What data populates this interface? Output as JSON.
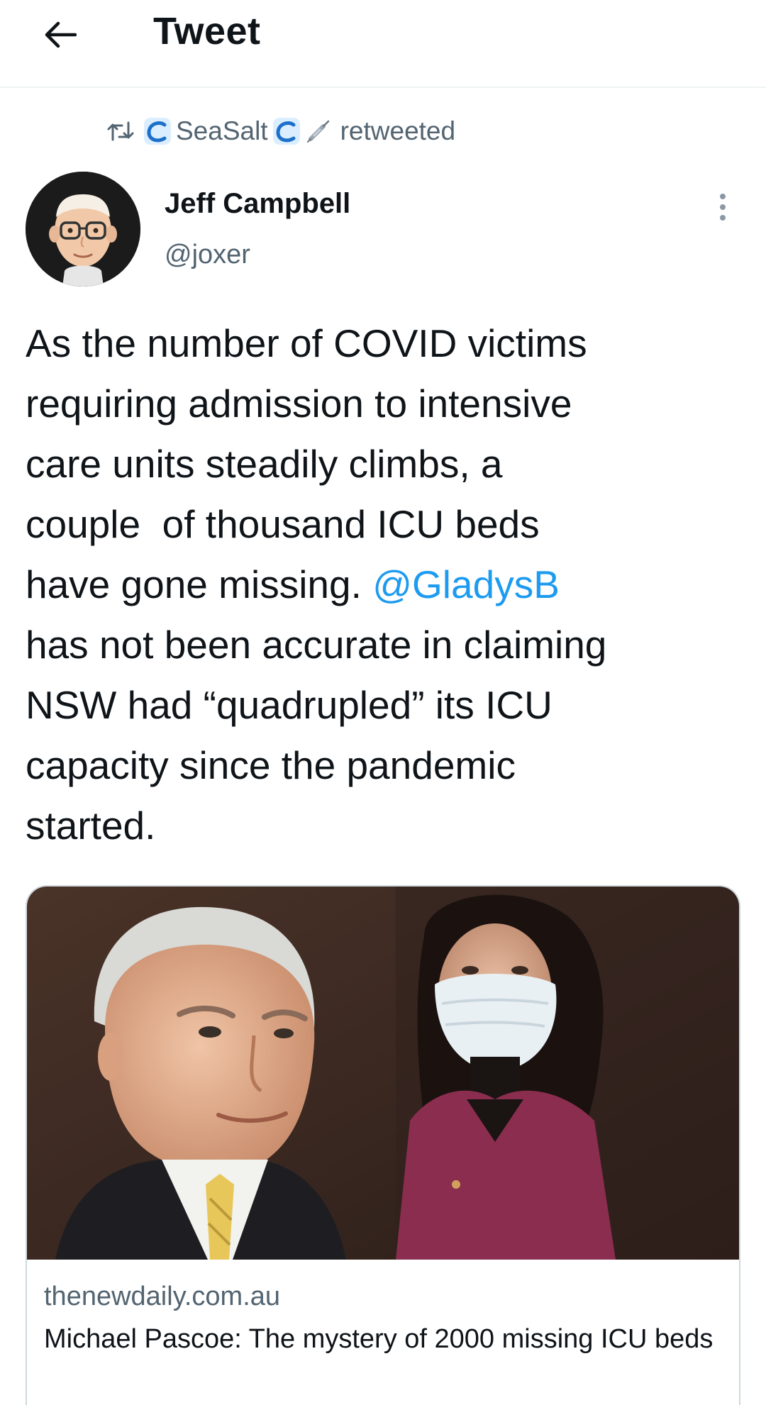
{
  "header": {
    "title": "Tweet",
    "back_icon": "arrow-left-icon"
  },
  "retweet_context": {
    "icon": "retweet-icon",
    "retweeter_name": "SeaSalt",
    "emoji_icons": [
      "water-wave-icon",
      "water-wave-icon",
      "syringe-icon"
    ],
    "action_text": "retweeted"
  },
  "tweet": {
    "author": {
      "display_name": "Jeff Campbell",
      "handle": "@joxer",
      "avatar_icon": "memoji-avatar"
    },
    "text_before_mention": "As the number of COVID victims\nrequiring admission to intensive\ncare units steadily climbs, a\ncouple  of thousand ICU beds\nhave gone missing. ",
    "mention": "@GladysB",
    "text_after_mention": "\nhas not been accurate in claiming\nNSW had “quadrupled” its ICU\ncapacity since the pandemic\nstarted.",
    "more_icon": "more-vertical-icon"
  },
  "link_card": {
    "domain": "thenewdaily.com.au",
    "title": "Michael Pascoe: The mystery of 2000 missing ICU beds",
    "image_description_icon": "article-photo"
  },
  "colors": {
    "link_blue": "#1d9bf0",
    "secondary_text": "#536471",
    "primary_text": "#0f1419",
    "border": "#cfd9de"
  }
}
